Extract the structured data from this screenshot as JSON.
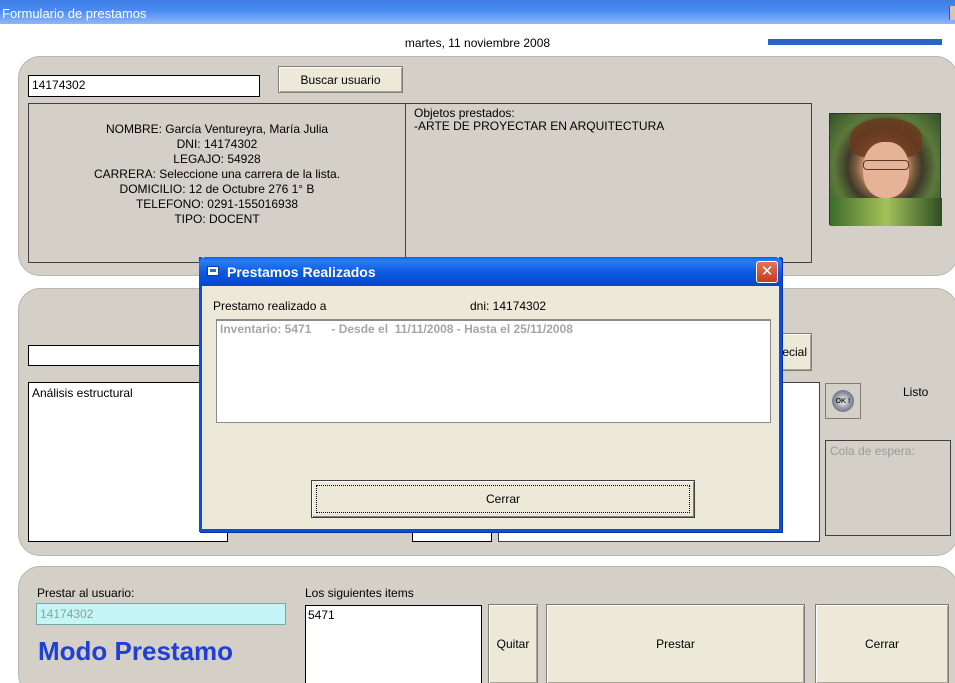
{
  "window": {
    "title": "Formulario de prestamos"
  },
  "header": {
    "date": "martes, 11 noviembre 2008",
    "progress": 1.0
  },
  "user_search": {
    "input_value": "14174302",
    "button_label": "Buscar usuario"
  },
  "user_info": {
    "nombre": "NOMBRE: García Ventureyra, María Julia",
    "dni": "DNI: 14174302",
    "legajo": "LEGAJO: 54928",
    "carrera": "CARRERA: Seleccione una carrera de la lista.",
    "domicilio": "DOMICILIO: 12 de Octubre 276 1° B",
    "telefono": "TELEFONO: 0291-155016938",
    "tipo": "TIPO: DOCENT"
  },
  "objects": {
    "header": "Objetos prestados:",
    "item": "-ARTE DE PROYECTAR EN ARQUITECTURA"
  },
  "search_panel": {
    "analysis_text": "Análisis estructural",
    "special_button_fragment": "ecial",
    "ready_label": "Listo",
    "ok_icon_label": "OK !",
    "queue_placeholder": "Cola de espera:"
  },
  "loan": {
    "user_label": "Prestar al usuario:",
    "user_value": "14174302",
    "mode_label": "Modo Prestamo",
    "items_label": "Los siguientes items",
    "items": [
      "5471"
    ],
    "remove_button": "Quitar",
    "lend_button": "Prestar",
    "close_button": "Cerrar"
  },
  "dialog": {
    "title": "Prestamos Realizados",
    "close_glyph": "✕",
    "line_prefix": "Prestamo realizado a",
    "dni": "dni: 14174302",
    "rows": [
      "Inventario: 5471      - Desde el  11/11/2008 - Hasta el 25/11/2008"
    ],
    "button_label": "Cerrar"
  },
  "colors": {
    "titlebar": "#4a8cf2",
    "dialog_titlebar": "#0b58e0",
    "mode_text": "#1f3fd6",
    "user_field_bg": "#c5f5f5"
  }
}
